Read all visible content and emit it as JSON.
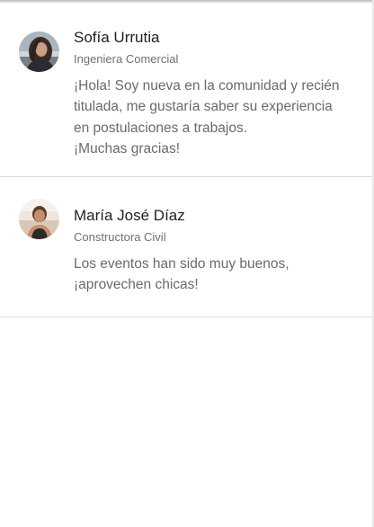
{
  "posts": [
    {
      "author": "Sofía Urrutia",
      "role": "Ingeniera Comercial",
      "avatar_icon": "user-photo-avatar",
      "message_lines": [
        "¡Hola! Soy nueva en la comunidad y recién",
        "titulada, me gustaría saber su experiencia",
        "en postulaciones a trabajos.",
        "¡Muchas gracias!"
      ]
    },
    {
      "author": "María José Díaz",
      "role": "Constructora Civil",
      "avatar_icon": "user-photo-avatar",
      "message_lines": [
        "Los eventos han sido muy buenos,",
        "¡aprovechen chicas!"
      ]
    }
  ],
  "colors": {
    "name_text": "#212121",
    "role_text": "#6f6f6f",
    "message_text": "#6a6a6a",
    "divider": "#dcdcdc",
    "background": "#ffffff"
  }
}
